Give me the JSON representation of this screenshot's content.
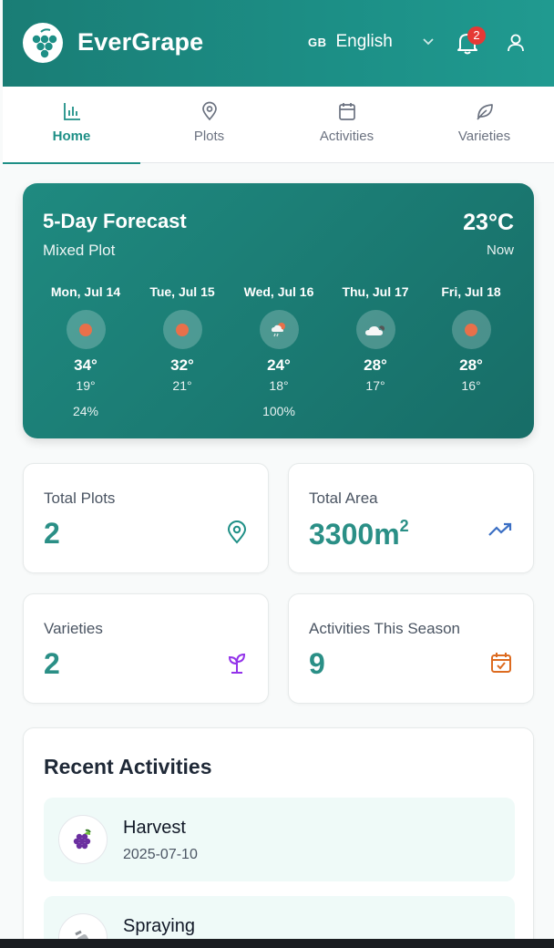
{
  "header": {
    "brand": "EverGrape",
    "lang_flag": "GB",
    "language": "English",
    "notification_count": "2"
  },
  "tabs": [
    {
      "label": "Home",
      "icon": "bar-chart-icon",
      "active": true
    },
    {
      "label": "Plots",
      "icon": "map-pin-icon"
    },
    {
      "label": "Activities",
      "icon": "calendar-icon"
    },
    {
      "label": "Varieties",
      "icon": "leaf-icon"
    }
  ],
  "forecast": {
    "title": "5-Day Forecast",
    "subtitle": "Mixed Plot",
    "current_temp": "23°C",
    "current_label": "Now",
    "days": [
      {
        "name": "Mon, Jul 14",
        "icon": "sun-icon",
        "high": "34°",
        "low": "19°",
        "precip": "24%"
      },
      {
        "name": "Tue, Jul 15",
        "icon": "sun-icon",
        "high": "32°",
        "low": "21°",
        "precip": ""
      },
      {
        "name": "Wed, Jul 16",
        "icon": "rain-sun-icon",
        "high": "24°",
        "low": "18°",
        "precip": "100%"
      },
      {
        "name": "Thu, Jul 17",
        "icon": "cloud-icon",
        "high": "28°",
        "low": "17°",
        "precip": ""
      },
      {
        "name": "Fri, Jul 18",
        "icon": "sun-icon",
        "high": "28°",
        "low": "16°",
        "precip": ""
      }
    ]
  },
  "stats": {
    "total_plots": {
      "label": "Total Plots",
      "value": "2"
    },
    "total_area": {
      "label": "Total Area",
      "value": "3300m",
      "unit_sup": "2"
    },
    "varieties": {
      "label": "Varieties",
      "value": "2"
    },
    "activities": {
      "label": "Activities This Season",
      "value": "9"
    }
  },
  "recent": {
    "title": "Recent Activities",
    "items": [
      {
        "name": "Harvest",
        "date": "2025-07-10",
        "icon": "grapes-icon"
      },
      {
        "name": "Spraying",
        "date": "",
        "icon": "sprayer-icon"
      }
    ]
  },
  "colors": {
    "primary": "#1e8f86",
    "badge": "#e53935",
    "trend": "#3b6fc4",
    "sprout": "#9333ea",
    "calendar": "#dd6b20",
    "sun": "#e8704a"
  }
}
